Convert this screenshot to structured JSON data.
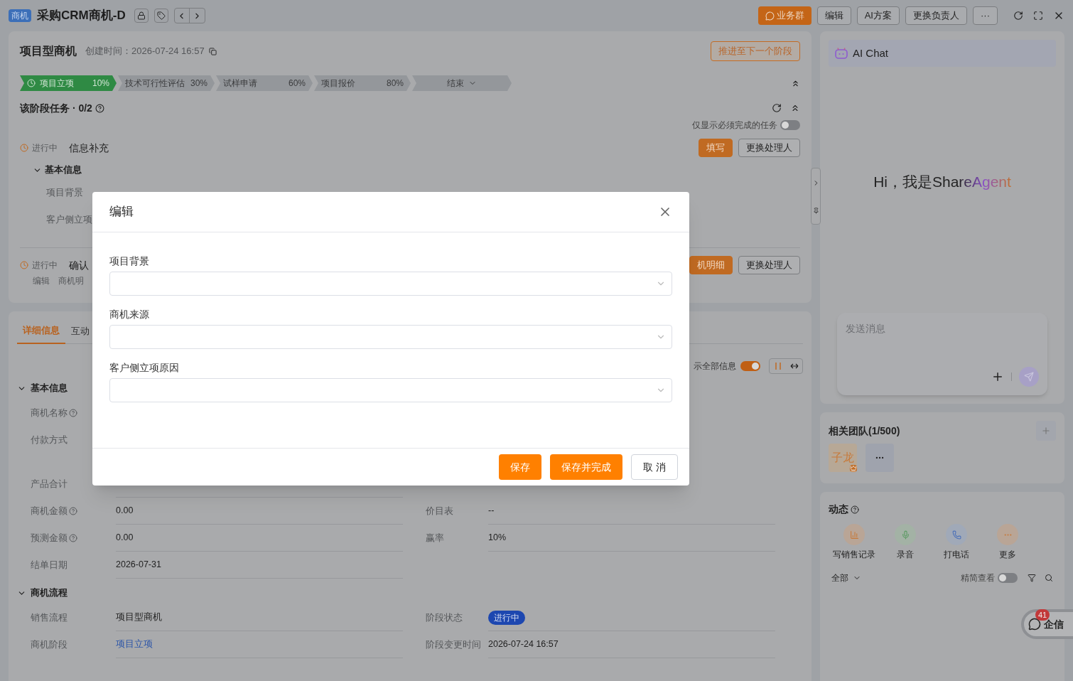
{
  "header": {
    "badge": "商机",
    "title": "采购CRM商机-D",
    "actions": [
      {
        "kind": "primary",
        "label": "业务群"
      },
      {
        "kind": "plain",
        "label": "编辑"
      },
      {
        "kind": "plain",
        "label": "AI方案"
      },
      {
        "kind": "plain",
        "label": "更换负责人"
      },
      {
        "kind": "plain",
        "label": "···"
      }
    ]
  },
  "summary": {
    "title": "项目型商机",
    "created": "创建时间：2026-07-24 16:57",
    "advance_button": "推进至下一个阶段",
    "stages": [
      {
        "name": "项目立项",
        "percent": "10%",
        "selected": true
      },
      {
        "name": "技术可行性评估",
        "percent": "30%",
        "selected": false
      },
      {
        "name": "试样申请",
        "percent": "60%",
        "selected": false
      },
      {
        "name": "项目报价",
        "percent": "80%",
        "selected": false
      },
      {
        "name": "结束",
        "selected": false
      }
    ],
    "tasks_title": "该阶段任务 · 0/2",
    "only_required": {
      "label": "仅显示必须完成的任务",
      "on": false
    },
    "tasks": [
      {
        "status": "进行中",
        "title": "信息补充",
        "buttons": [
          {
            "kind": "primary",
            "label": "填写"
          },
          {
            "kind": "plain",
            "label": "更换处理人"
          }
        ],
        "group": {
          "title": "基本信息",
          "expanded": true,
          "fields": [
            "项目背景",
            "客户侧立项"
          ]
        }
      },
      {
        "status": "进行中",
        "title": "确认",
        "links": [
          "编辑",
          "商机明"
        ],
        "buttons": [
          {
            "kind": "primary",
            "label": "机明细"
          },
          {
            "kind": "plain",
            "label": "更换处理人"
          }
        ]
      }
    ]
  },
  "details": {
    "tabs": [
      {
        "label": "详细信息",
        "selected": true
      },
      {
        "label": "互动",
        "selected": false
      }
    ],
    "show_all": {
      "label": "示全部信息",
      "on": true
    },
    "sections": [
      {
        "title": "基本信息",
        "expanded": true,
        "rows": [
          {
            "fields": [
              {
                "label": "商机名称",
                "help": true
              }
            ]
          },
          {
            "fields": [
              {
                "label": "付款方式",
                "help": false
              }
            ]
          },
          {
            "fields": [
              {
                "label": "产品合计",
                "help": false
              }
            ]
          },
          {
            "fields": [
              {
                "label": "商机金额",
                "help": true,
                "value": "0.00"
              },
              {
                "label": "价目表",
                "help": false,
                "value": "--"
              }
            ]
          },
          {
            "fields": [
              {
                "label": "预测金额",
                "help": true,
                "value": "0.00"
              },
              {
                "label": "赢率",
                "help": false,
                "value": "10%"
              }
            ]
          },
          {
            "fields": [
              {
                "label": "结单日期",
                "help": false,
                "value": "2026-07-31"
              }
            ]
          }
        ]
      },
      {
        "title": "商机流程",
        "expanded": true,
        "rows": [
          {
            "fields": [
              {
                "label": "销售流程",
                "help": false,
                "value": "项目型商机",
                "kind": "text"
              },
              {
                "label": "阶段状态",
                "help": false,
                "value": "进行中",
                "kind": "badge"
              }
            ]
          },
          {
            "fields": [
              {
                "label": "商机阶段",
                "help": false,
                "value": "项目立项",
                "kind": "link"
              },
              {
                "label": "阶段变更时间",
                "help": false,
                "value": "2026-07-24 16:57",
                "kind": "text"
              }
            ]
          }
        ]
      }
    ]
  },
  "modal": {
    "title": "编辑",
    "fields": [
      {
        "label": "项目背景"
      },
      {
        "label": "商机来源"
      },
      {
        "label": "客户侧立项原因"
      }
    ],
    "buttons": [
      {
        "kind": "primary",
        "label": "保存"
      },
      {
        "kind": "primary",
        "label": "保存并完成"
      },
      {
        "kind": "plain",
        "label": "取 消"
      }
    ]
  },
  "ai_chat": {
    "title": "AI Chat",
    "greeting": "Hi，我是ShareAgent",
    "placeholder": "发送消息"
  },
  "team": {
    "title": "相关团队(1/500)",
    "members": [
      "子龙"
    ]
  },
  "activity": {
    "title": "动态",
    "actions": [
      {
        "kind": "note",
        "label": "写销售记录"
      },
      {
        "kind": "mic",
        "label": "录音"
      },
      {
        "kind": "phone",
        "label": "打电话"
      },
      {
        "kind": "more",
        "label": "更多"
      }
    ],
    "filter": "全部",
    "compact": {
      "label": "精简查看",
      "on": false
    }
  },
  "messenger": {
    "label": "企信",
    "count": "41"
  }
}
